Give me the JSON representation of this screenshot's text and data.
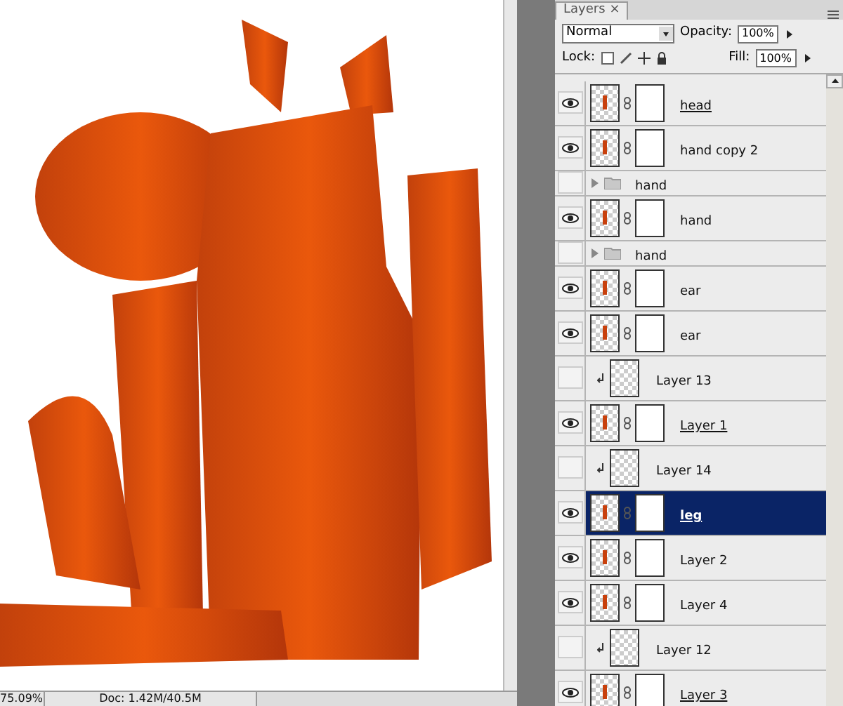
{
  "panel": {
    "tab": "Layers",
    "close": "×",
    "blend_mode": "Normal",
    "opacity_label": "Opacity:",
    "opacity": "100%",
    "lock_label": "Lock:",
    "fill_label": "Fill:",
    "fill": "100%"
  },
  "layers": [
    {
      "kind": "layer",
      "name": "head",
      "visible": true,
      "selected": false,
      "linked": true
    },
    {
      "kind": "layer",
      "name": "hand copy 2",
      "visible": true,
      "selected": false,
      "linked": false
    },
    {
      "kind": "group",
      "name": "hand",
      "visible": false,
      "selected": false,
      "linked": false
    },
    {
      "kind": "layer",
      "name": "hand",
      "visible": true,
      "selected": false,
      "linked": false
    },
    {
      "kind": "group",
      "name": "hand",
      "visible": false,
      "selected": false,
      "linked": false
    },
    {
      "kind": "layer",
      "name": "ear",
      "visible": true,
      "selected": false,
      "linked": false
    },
    {
      "kind": "layer",
      "name": "ear",
      "visible": true,
      "selected": false,
      "linked": false
    },
    {
      "kind": "clipped",
      "name": "Layer 13",
      "visible": false,
      "selected": false,
      "linked": false
    },
    {
      "kind": "layer",
      "name": "Layer 1",
      "visible": true,
      "selected": false,
      "linked": true
    },
    {
      "kind": "clipped",
      "name": "Layer 14",
      "visible": false,
      "selected": false,
      "linked": false
    },
    {
      "kind": "layer",
      "name": "leg",
      "visible": true,
      "selected": true,
      "linked": true
    },
    {
      "kind": "layer",
      "name": "Layer 2",
      "visible": true,
      "selected": false,
      "linked": false
    },
    {
      "kind": "layer",
      "name": "Layer 4",
      "visible": true,
      "selected": false,
      "linked": false
    },
    {
      "kind": "clipped",
      "name": "Layer 12",
      "visible": false,
      "selected": false,
      "linked": false
    },
    {
      "kind": "layer",
      "name": "Layer 3",
      "visible": true,
      "selected": false,
      "linked": true
    }
  ],
  "status_bar": {
    "zoom": "75.09%",
    "doc": "Doc: 1.42M/40.5M"
  }
}
